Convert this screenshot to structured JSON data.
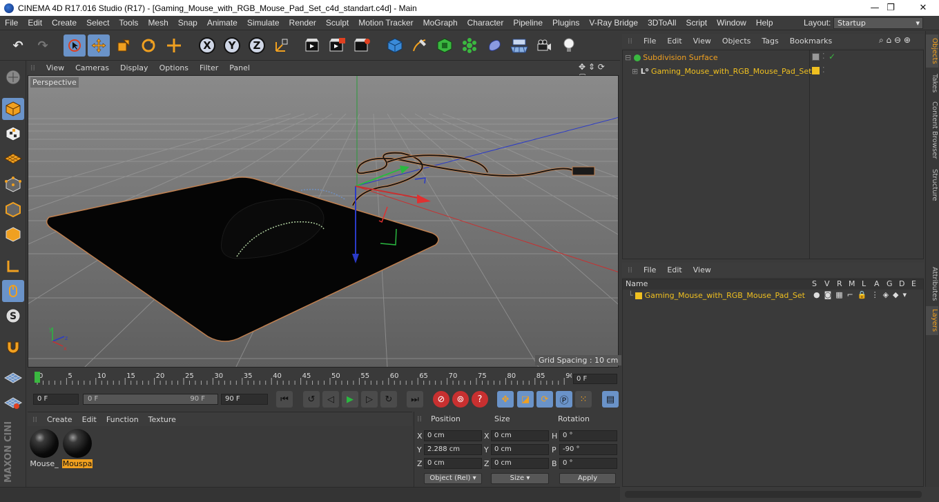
{
  "window": {
    "title": "CINEMA 4D R17.016 Studio (R17) - [Gaming_Mouse_with_RGB_Mouse_Pad_Set_c4d_standart.c4d] - Main",
    "controls": [
      "—",
      "❐",
      "✕"
    ]
  },
  "menubar": [
    "File",
    "Edit",
    "Create",
    "Select",
    "Tools",
    "Mesh",
    "Snap",
    "Animate",
    "Simulate",
    "Render",
    "Sculpt",
    "Motion Tracker",
    "MoGraph",
    "Character",
    "Pipeline",
    "Plugins",
    "V-Ray Bridge",
    "3DToAll",
    "Script",
    "Window",
    "Help"
  ],
  "layout": {
    "label": "Layout:",
    "value": "Startup"
  },
  "toolbar": {
    "axes": [
      "X",
      "Y",
      "Z"
    ]
  },
  "viewport": {
    "menu": [
      "View",
      "Cameras",
      "Display",
      "Options",
      "Filter",
      "Panel"
    ],
    "label": "Perspective",
    "grid_spacing": "Grid Spacing : 10 cm"
  },
  "timeline": {
    "ticks": [
      "0",
      "5",
      "10",
      "15",
      "20",
      "25",
      "30",
      "35",
      "40",
      "45",
      "50",
      "55",
      "60",
      "65",
      "70",
      "75",
      "80",
      "85",
      "90"
    ],
    "current_frame": "0 F",
    "start_field": "0 F",
    "range_start": "0 F",
    "range_end": "90 F",
    "end_field": "90 F"
  },
  "materials": {
    "menu": [
      "Create",
      "Edit",
      "Function",
      "Texture"
    ],
    "items": [
      {
        "label": "Mouse_",
        "selected": false
      },
      {
        "label": "Mouspa",
        "selected": true
      }
    ]
  },
  "coordinates": {
    "headers": [
      "Position",
      "Size",
      "Rotation"
    ],
    "rows": [
      {
        "axis": "X",
        "pos": "0 cm",
        "size_axis": "X",
        "size": "0 cm",
        "rot_axis": "H",
        "rot": "0 °"
      },
      {
        "axis": "Y",
        "pos": "2.288 cm",
        "size_axis": "Y",
        "size": "0 cm",
        "rot_axis": "P",
        "rot": "-90 °"
      },
      {
        "axis": "Z",
        "pos": "0 cm",
        "size_axis": "Z",
        "size": "0 cm",
        "rot_axis": "B",
        "rot": "0 °"
      }
    ],
    "mode": "Object (Rel)",
    "size_mode": "Size",
    "apply": "Apply"
  },
  "objects_panel": {
    "menu": [
      "File",
      "Edit",
      "View",
      "Objects",
      "Tags",
      "Bookmarks"
    ],
    "rows": [
      {
        "name": "Subdivision Surface",
        "color": "#f0a020"
      },
      {
        "name": "Gaming_Mouse_with_RGB_Mouse_Pad_Set",
        "color": "#f0c020"
      }
    ]
  },
  "layers_panel": {
    "menu": [
      "File",
      "Edit",
      "View"
    ],
    "columns": [
      "Name",
      "S",
      "V",
      "R",
      "M",
      "L",
      "A",
      "G",
      "D",
      "E"
    ],
    "rows": [
      {
        "name": "Gaming_Mouse_with_RGB_Mouse_Pad_Set"
      }
    ]
  },
  "side_tabs": [
    "Objects",
    "Takes",
    "Content Browser",
    "Structure",
    "Attributes",
    "Layers"
  ],
  "branding": "MAXON CINEMA 4D"
}
